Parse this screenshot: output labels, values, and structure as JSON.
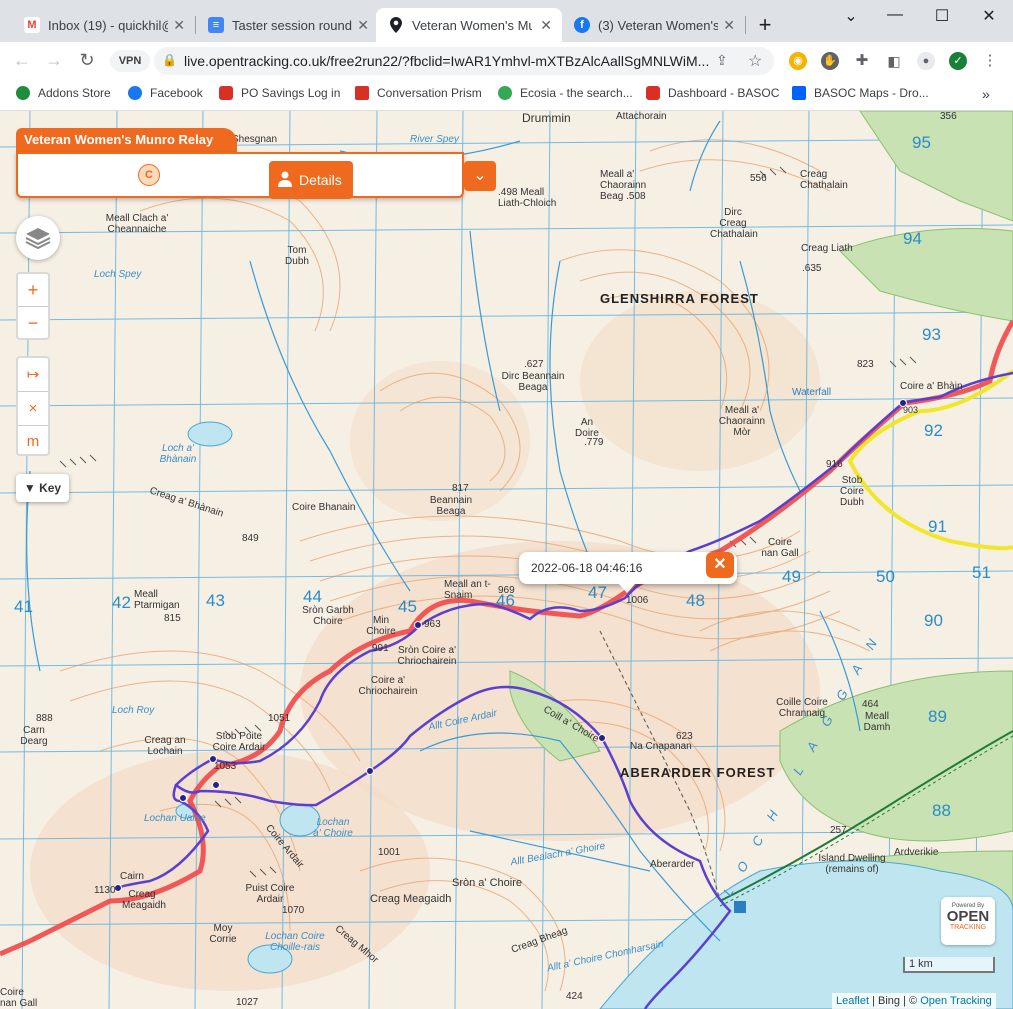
{
  "browser": {
    "tabs": [
      {
        "label": "Inbox (19) - quickhil@",
        "icon": "gmail-icon"
      },
      {
        "label": "Taster session round-u",
        "icon": "docs-icon"
      },
      {
        "label": "Veteran Women's Mun",
        "icon": "location-pin-icon",
        "active": true
      },
      {
        "label": "(3) Veteran Women's R",
        "icon": "facebook-icon"
      }
    ],
    "url": "live.opentracking.co.uk/free2run22/?fbclid=IwAR1Ymhvl-mXTBzAlcAallSgMNLWiM...",
    "vpn_label": "VPN",
    "bookmarks": [
      {
        "label": "Addons Store",
        "color": "#1e8e3e"
      },
      {
        "label": "Facebook",
        "color": "#1877f2"
      },
      {
        "label": "PO Savings Log in",
        "color": "#d93025"
      },
      {
        "label": "Conversation Prism",
        "color": "#d93025"
      },
      {
        "label": "Ecosia - the search...",
        "color": "#34a853"
      },
      {
        "label": "Dashboard - BASOC",
        "color": "#d93025"
      },
      {
        "label": "BASOC Maps - Dro...",
        "color": "#0061fe"
      }
    ]
  },
  "tracker": {
    "event_title": "Veteran Women's Munro Relay",
    "runner_initial": "C",
    "details_label": "Details",
    "key_label": "Key",
    "popup_time": "2022-06-18 04:46:16",
    "scale_label": "1 km",
    "logo_small": "Powered By",
    "logo_big": "OPEN",
    "logo_sub": "TRACKING",
    "attribution": {
      "leaflet": "Leaflet",
      "bing": "Bing",
      "sep": " | ",
      "copy": "© ",
      "ot": "Open Tracking"
    },
    "colors": {
      "accent": "#ef6a1f",
      "track_red": "#f04848",
      "track_purple": "#5a3fd1",
      "track_yellow": "#f2e62a"
    }
  },
  "map": {
    "labels": [
      "Drummin",
      "Attachorain",
      "Shesgnan",
      "River Spey",
      "Meall Clach a' Cheannaiche",
      "Tom Dubh",
      "Loch Spey",
      ".498 Meall Liath-Chloich",
      "Meall a' Chaorainn Beag .508",
      "556",
      "Creag Chathalain",
      "Dirc Creag Chathalain",
      "Creag Liath",
      ".635",
      "GLENSHIRRA FOREST",
      ".627",
      "Dirc Beannain Beaga",
      "An Doire",
      ".779",
      "Meall a' Chaorainn Mòr",
      "823",
      "Coire a' Bhàin",
      "903",
      "916",
      "Stob Coire Dubh",
      "Waterfall",
      "817",
      "Beannain Beaga",
      "Coire Bhanain",
      "Creag a' Bhànain",
      "849",
      "Loch a' Bhànain",
      "Meall an t-Snaim",
      "969",
      "1006",
      "Coire nan Gall",
      "Meall Ptarmigan",
      "815",
      "Sròn Garbh Choire",
      "Min Choire",
      "963",
      "991",
      "Sròn Coire a' Chriochairein",
      "Coire a' Chriochairein",
      "Loch Roy",
      "888",
      "Carn Dearg",
      "Creag an Lochain",
      "Stob Poite Coire Ardair",
      "1053",
      "1051",
      "Allt Coire Ardair",
      "Coill a' Choire",
      "Na Cnapanan",
      "623",
      "ABERARDER FOREST",
      "Coille Coire Chrannaig",
      "464",
      "Meall Damh",
      "Lochan Uaine",
      "Lochan a' Choire",
      "1001",
      "Coire Ardair",
      "Puist Coire Ardair",
      "1070",
      "Cairn",
      "1130",
      "Creag Meagaidh",
      "Sròn a' Choire",
      "Creag Meagaidh",
      "Allt Bealach a' Ghoire",
      "Aberarder",
      "Island Dwelling (remains of)",
      "Ardverikie",
      "257",
      "Moy Corrie",
      "Lochan Coire Choille-rais",
      "Creag Mhor",
      "Creag Bheag",
      "Allt a' Choire Chomharsain",
      "424",
      "1027",
      "Coire nan Gall",
      "LOCH LAGGAN",
      "356"
    ],
    "grid_east": [
      "41",
      "42",
      "43",
      "44",
      "45",
      "46",
      "47",
      "48",
      "49",
      "50",
      "51"
    ],
    "grid_north": [
      "95",
      "94",
      "93",
      "92",
      "91",
      "90",
      "89",
      "88"
    ]
  }
}
